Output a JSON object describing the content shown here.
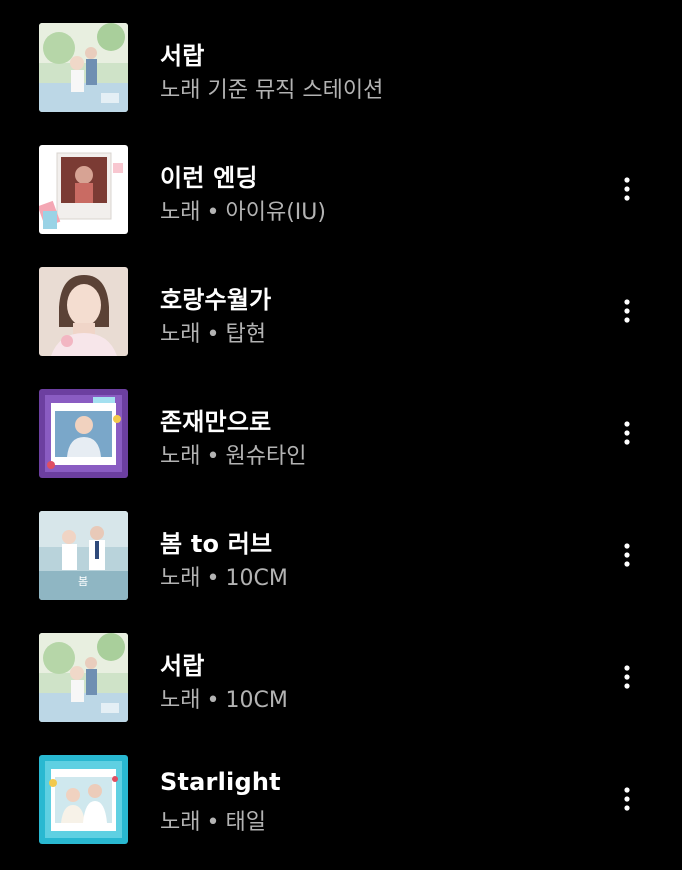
{
  "items": [
    {
      "title": "서랍",
      "type": "노래 기준 뮤직 스테이션",
      "artist": "",
      "separator": "",
      "has_menu": false,
      "art": "seorap-cover"
    },
    {
      "title": "이런 엔딩",
      "type": "노래",
      "artist": "아이유(IU)",
      "separator": "•",
      "has_menu": true,
      "art": "polaroid-cover"
    },
    {
      "title": "호랑수월가",
      "type": "노래",
      "artist": "탑현",
      "separator": "•",
      "has_menu": true,
      "art": "portrait-cover"
    },
    {
      "title": "존재만으로",
      "type": "노래",
      "artist": "원슈타인",
      "separator": "•",
      "has_menu": true,
      "art": "purple-frame-cover"
    },
    {
      "title": "봄 to 러브",
      "type": "노래",
      "artist": "10CM",
      "separator": "•",
      "has_menu": true,
      "art": "school-couple-cover"
    },
    {
      "title": "서랍",
      "type": "노래",
      "artist": "10CM",
      "separator": "•",
      "has_menu": true,
      "art": "seorap-cover"
    },
    {
      "title": "Starlight",
      "type": "노래",
      "artist": "태일",
      "separator": "•",
      "has_menu": true,
      "art": "cyan-frame-cover"
    }
  ],
  "colors": {
    "background": "#000000",
    "title": "#ffffff",
    "subtitle": "#b3b3b3"
  },
  "icons": {
    "more": "more-vertical-icon"
  }
}
